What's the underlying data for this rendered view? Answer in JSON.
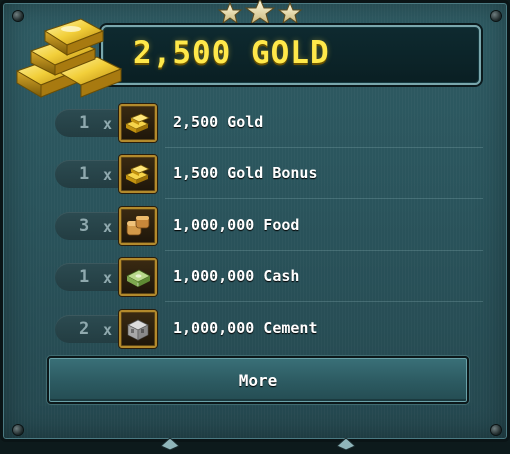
{
  "header": {
    "title": "2,500 GOLD",
    "icon": "gold-bars-pile"
  },
  "items": [
    {
      "qty": "1",
      "times": "x",
      "label": "2,500 Gold",
      "icon": "gold-bars"
    },
    {
      "qty": "1",
      "times": "x",
      "label": "1,500 Gold Bonus",
      "icon": "gold-bars"
    },
    {
      "qty": "3",
      "times": "x",
      "label": "1,000,000 Food",
      "icon": "bread-loaves"
    },
    {
      "qty": "1",
      "times": "x",
      "label": "1,000,000 Cash",
      "icon": "cash-stack"
    },
    {
      "qty": "2",
      "times": "x",
      "label": "1,000,000 Cement",
      "icon": "cement-block"
    }
  ],
  "more_button": {
    "label": "More"
  },
  "colors": {
    "title_gold": "#ffe84a",
    "panel_teal": "#2a545c",
    "frame_bronze": "#b38a2c"
  }
}
